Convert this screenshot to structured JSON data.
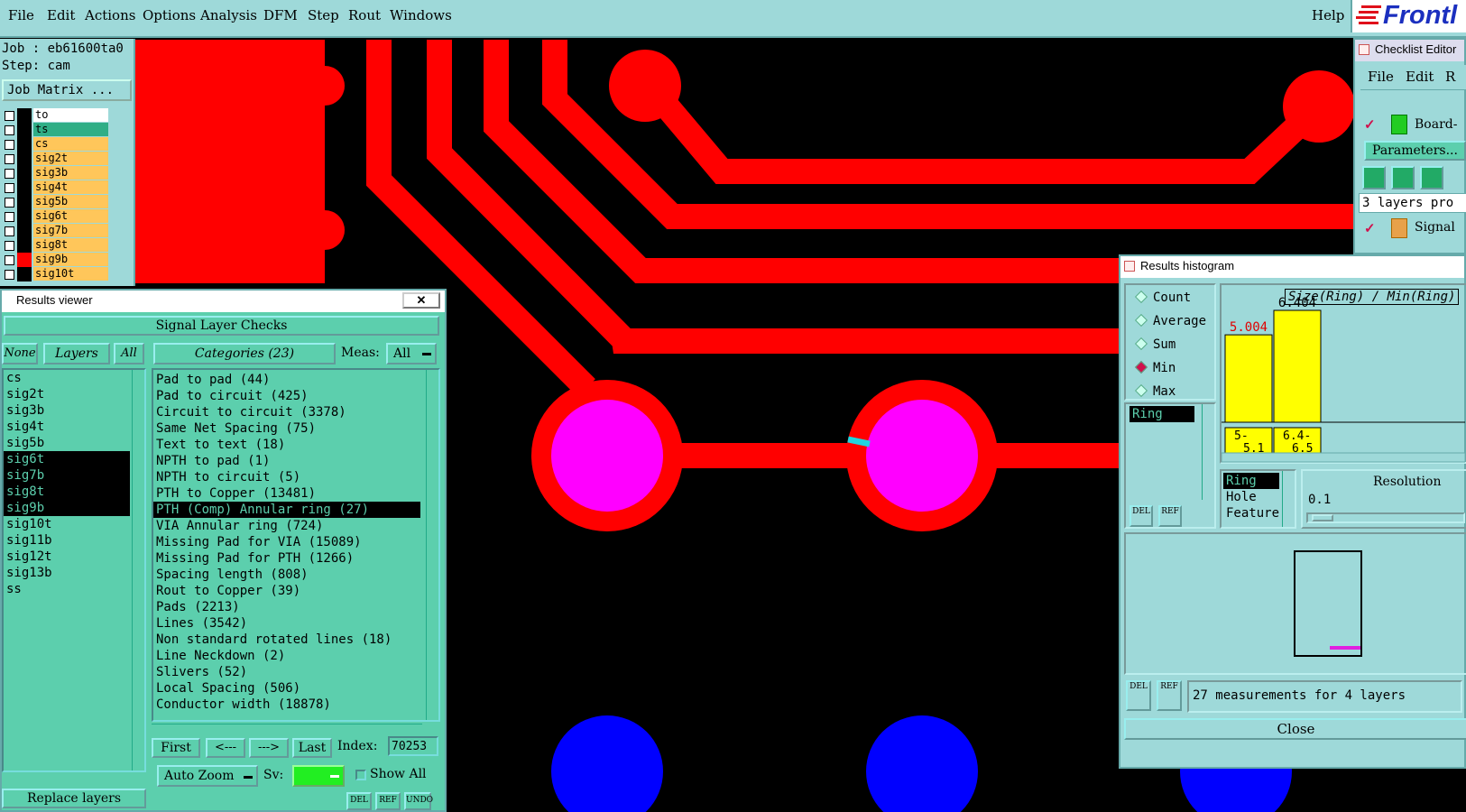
{
  "menubar": {
    "items": [
      "File",
      "Edit",
      "Actions",
      "Options",
      "Analysis",
      "DFM",
      "Step",
      "Rout",
      "Windows"
    ],
    "help": "Help",
    "brand": "Frontl"
  },
  "job": {
    "job_line": "Job : eb61600ta0",
    "step_line": "Step: cam",
    "matrix_button": "Job Matrix ...",
    "layers": [
      "to",
      "ts",
      "cs",
      "sig2t",
      "sig3b",
      "sig4t",
      "sig5b",
      "sig6t",
      "sig7b",
      "sig8t",
      "sig9b",
      "sig10t"
    ]
  },
  "results_viewer": {
    "title": "Results viewer",
    "header": "Signal Layer Checks",
    "none_label": "None",
    "layers_label": "Layers",
    "all_label": "All",
    "categories_label": "Categories (23)",
    "meas_label": "Meas:",
    "meas_value": "All",
    "layer_items": [
      "cs",
      "sig2t",
      "sig3b",
      "sig4t",
      "sig5b",
      "sig6t",
      "sig7b",
      "sig8t",
      "sig9b",
      "sig10t",
      "sig11b",
      "sig12t",
      "sig13b",
      "ss"
    ],
    "categories": [
      "Pad to pad (44)",
      "Pad to circuit (425)",
      "Circuit to circuit (3378)",
      "Same Net Spacing (75)",
      "Text to text (18)",
      "NPTH to pad (1)",
      "NPTH to circuit (5)",
      "PTH to Copper (13481)",
      "PTH (Comp) Annular ring (27)",
      "VIA Annular ring (724)",
      "Missing Pad for VIA (15089)",
      "Missing Pad for PTH (1266)",
      "Spacing length (808)",
      "Rout to Copper (39)",
      "Pads (2213)",
      "Lines (3542)",
      "Non standard rotated lines (18)",
      "Line Neckdown (2)",
      "Slivers (52)",
      "Local Spacing (506)",
      "Conductor width (18878)"
    ],
    "nav": {
      "first": "First",
      "prev": "<---",
      "next": "--->",
      "last": "Last",
      "index_label": "Index:",
      "index_value": "70253"
    },
    "auto_zoom": "Auto Zoom",
    "sv_label": "Sv:",
    "show_all": "Show All",
    "replace_layers": "Replace layers",
    "small_buttons": [
      "DEL",
      "REF",
      "UNDO"
    ]
  },
  "histogram": {
    "title": "Results histogram",
    "radios": [
      "Count",
      "Average",
      "Sum",
      "Min",
      "Max"
    ],
    "selected_radio": "Min",
    "list_selected": "Ring",
    "chart_title": "Size(Ring) / Min(Ring)",
    "bars": [
      {
        "label": "5.004",
        "range": "5-\n5.1",
        "value": 5.004
      },
      {
        "label": "6.404",
        "range": "6.4-\n6.5",
        "value": 6.404
      }
    ],
    "measure_list": [
      "Ring",
      "Hole",
      "Feature"
    ],
    "resolution_label": "Resolution",
    "resolution_value": "0.1",
    "del": "DEL",
    "ref": "REF",
    "status": "27 measurements for 4 layers",
    "close": "Close"
  },
  "checklist": {
    "title": "Checklist Editor",
    "menu": [
      "File",
      "Edit",
      "R"
    ],
    "board_item": "Board-",
    "parameters": "Parameters...",
    "status": "3 layers pro",
    "signal_item": "Signal "
  }
}
